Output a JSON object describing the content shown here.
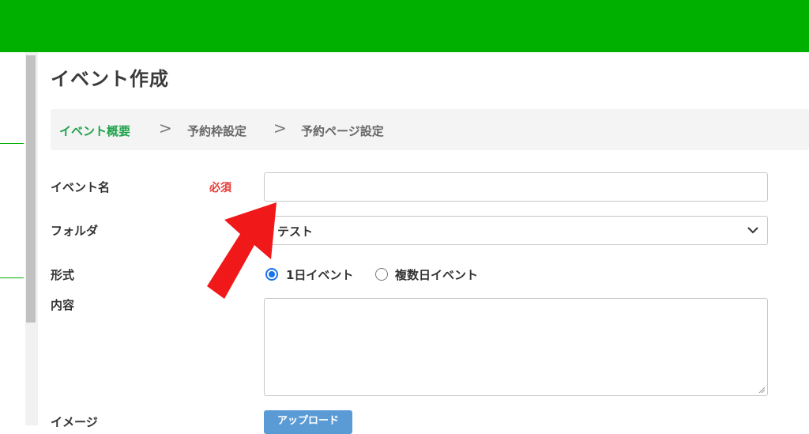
{
  "page": {
    "title": "イベント作成"
  },
  "steps": [
    {
      "label": "イベント概要",
      "active": true
    },
    {
      "label": "予約枠設定",
      "active": false
    },
    {
      "label": "予約ページ設定",
      "active": false
    }
  ],
  "step_separator": ">",
  "form": {
    "event_name": {
      "label": "イベント名",
      "required_badge": "必須",
      "value": "",
      "placeholder": ""
    },
    "folder": {
      "label": "フォルダ",
      "selected": "テスト"
    },
    "format": {
      "label": "形式",
      "options": [
        {
          "label": "1日イベント",
          "checked": true
        },
        {
          "label": "複数日イベント",
          "checked": false
        }
      ]
    },
    "content": {
      "label": "内容",
      "value": ""
    },
    "image": {
      "label": "イメージ",
      "upload_label": "アップロード"
    }
  },
  "colors": {
    "header": "#00b000",
    "active_step": "#1fa24a",
    "required": "#e53935",
    "radio": "#1a73e8",
    "upload_button": "#5b9bd5",
    "annotation_arrow": "#f01818"
  },
  "icons": {
    "step_separator": "chevron-right-icon",
    "select": "chevron-down-icon",
    "annotation": "red-arrow-icon"
  }
}
